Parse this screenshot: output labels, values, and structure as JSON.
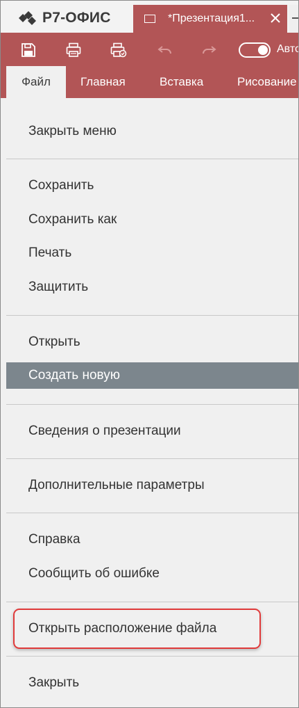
{
  "app": {
    "logo_text": "Р7-ОФИС",
    "doc_tab_title": "*Презентация1...",
    "brand_color": "#b25556"
  },
  "toolbar": {
    "icons": [
      "save-icon",
      "print-icon",
      "quick-print-icon",
      "undo-icon",
      "redo-icon"
    ],
    "autosave_label": "Автосохранение",
    "autosave_on": true
  },
  "ribbon": {
    "tabs": [
      {
        "label": "Файл",
        "active": true
      },
      {
        "label": "Главная",
        "active": false
      },
      {
        "label": "Вставка",
        "active": false
      },
      {
        "label": "Рисование",
        "active": false
      }
    ]
  },
  "file_menu": {
    "items": [
      {
        "label": "Закрыть меню"
      },
      {
        "label": "Сохранить"
      },
      {
        "label": "Сохранить как"
      },
      {
        "label": "Печать"
      },
      {
        "label": "Защитить"
      },
      {
        "label": "Открыть"
      },
      {
        "label": "Создать новую",
        "selected": true
      },
      {
        "label": "Сведения о презентации"
      },
      {
        "label": "Дополнительные параметры"
      },
      {
        "label": "Справка"
      },
      {
        "label": "Сообщить об ошибке"
      },
      {
        "label": "Открыть расположение файла",
        "highlighted": true
      },
      {
        "label": "Закрыть"
      }
    ]
  }
}
